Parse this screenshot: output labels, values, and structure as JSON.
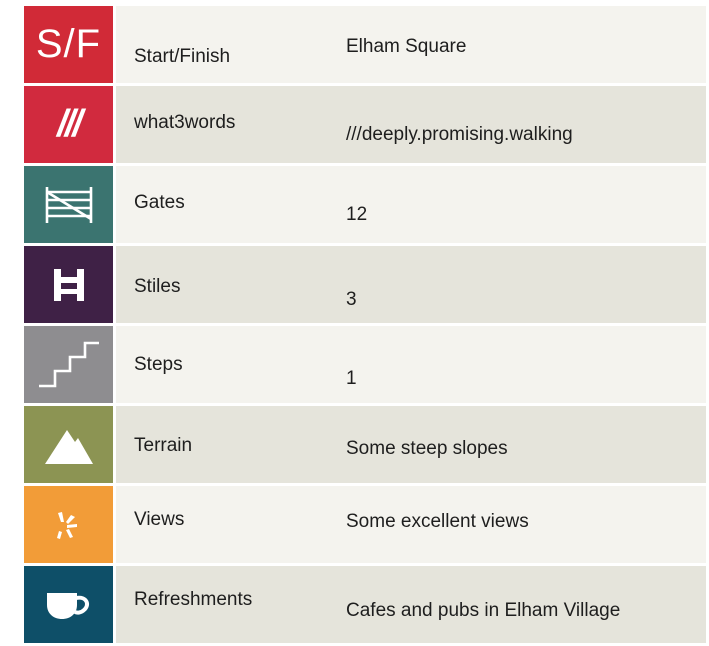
{
  "rows": [
    {
      "icon": "start-finish-icon",
      "icon_text": "S/F",
      "label": "Start/Finish",
      "value": "Elham Square",
      "color": "#d12a37"
    },
    {
      "icon": "what3words-icon",
      "icon_text": "///",
      "label": "what3words",
      "value": "///deeply.promising.walking",
      "color": "#d12a3e"
    },
    {
      "icon": "gate-icon",
      "label": "Gates",
      "value": "12",
      "color": "#3b7470"
    },
    {
      "icon": "stile-icon",
      "label": "Stiles",
      "value": "3",
      "color": "#3f2146"
    },
    {
      "icon": "steps-icon",
      "label": "Steps",
      "value": "1",
      "color": "#8e8d90"
    },
    {
      "icon": "terrain-icon",
      "label": "Terrain",
      "value": "Some steep slopes",
      "color": "#8c9453"
    },
    {
      "icon": "views-icon",
      "label": "Views",
      "value": "Some excellent views",
      "color": "#f29c38"
    },
    {
      "icon": "refreshments-cup-icon",
      "label": "Refreshments",
      "value": "Cafes and pubs in Elham Village",
      "color": "#0e4f68"
    }
  ]
}
